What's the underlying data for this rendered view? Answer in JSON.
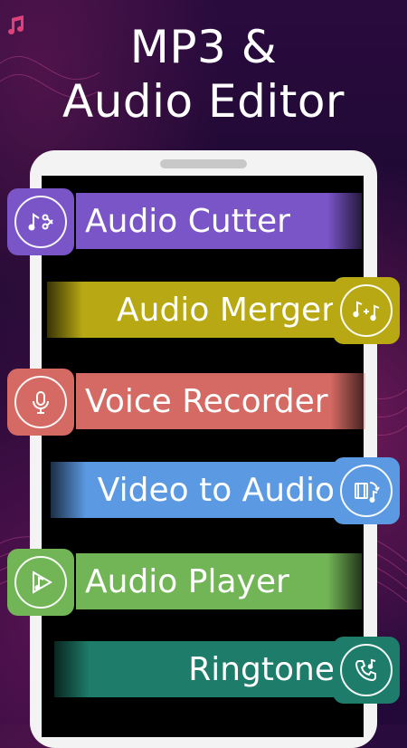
{
  "headline": {
    "line1": "MP3 &",
    "line2": "Audio Editor"
  },
  "colors": {
    "audio_cutter": "#7a55c8",
    "audio_merger": "#b8a814",
    "voice_recorder": "#d46a63",
    "video_to_audio": "#5b9ae2",
    "audio_player": "#72b556",
    "ringtone": "#1d7d6a"
  },
  "features": [
    {
      "label": "Audio Cutter",
      "icon": "music-scissors-icon"
    },
    {
      "label": "Audio Merger",
      "icon": "music-plus-icon"
    },
    {
      "label": "Voice Recorder",
      "icon": "microphone-icon"
    },
    {
      "label": "Video to Audio",
      "icon": "video-convert-icon"
    },
    {
      "label": "Audio Player",
      "icon": "play-note-icon"
    },
    {
      "label": "Ringtone",
      "icon": "phone-music-icon"
    }
  ]
}
